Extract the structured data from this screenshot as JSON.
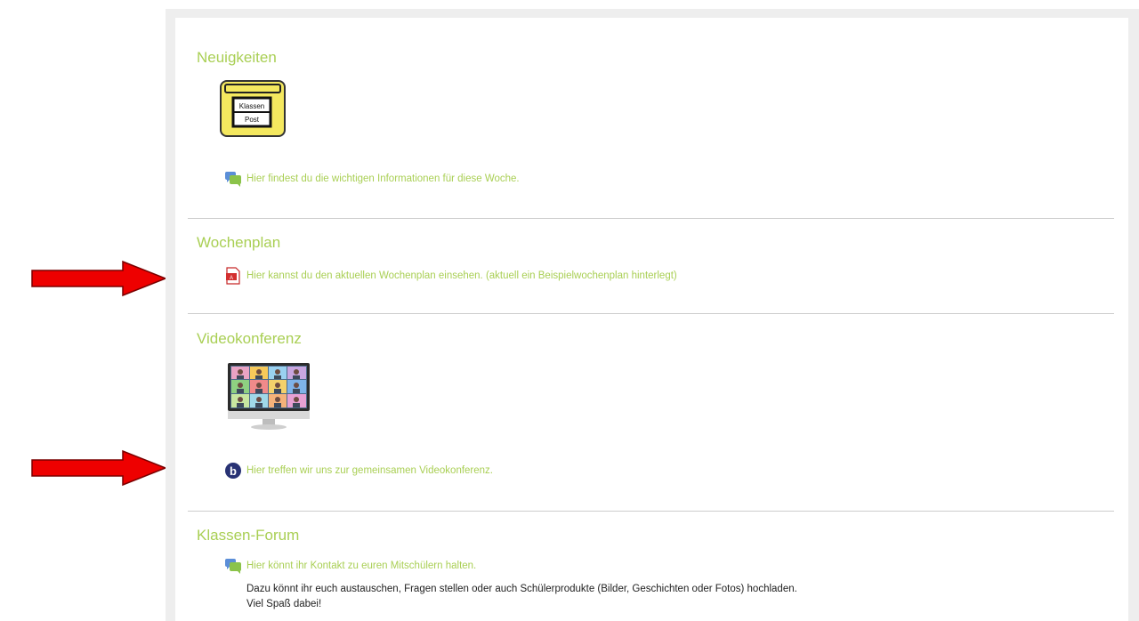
{
  "sections": {
    "news": {
      "title": "Neuigkeiten",
      "image_text_line1": "Klassen",
      "image_text_line2": "Post",
      "link": "Hier findest du die wichtigen Informationen für diese Woche."
    },
    "weekplan": {
      "title": "Wochenplan",
      "link": "Hier kannst du den aktuellen Wochenplan einsehen. (aktuell ein Beispielwochenplan hinterlegt)"
    },
    "video": {
      "title": "Videokonferenz",
      "link": "Hier treffen wir uns zur gemeinsamen Videokonferenz."
    },
    "forum": {
      "title": "Klassen-Forum",
      "link": "Hier könnt ihr Kontakt zu euren Mitschülern halten.",
      "description_line1": "Dazu könnt ihr euch austauschen, Fragen stellen oder auch Schülerprodukte (Bilder, Geschichten oder Fotos) hochladen.",
      "description_line2": "Viel Spaß dabei!"
    }
  },
  "colors": {
    "accent": "#a9cf54",
    "arrow": "#ee0000",
    "divider": "#cccccc"
  },
  "icons": {
    "forum": "forum-bubbles-icon",
    "pdf": "pdf-file-icon",
    "video": "bigbluebutton-icon"
  }
}
